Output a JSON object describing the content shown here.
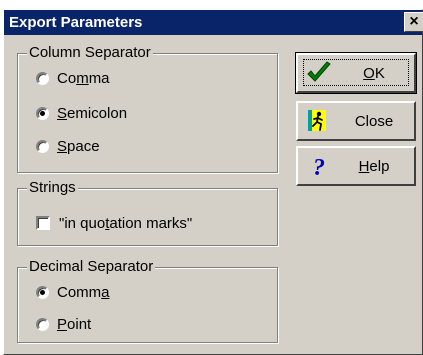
{
  "dialog": {
    "title": "Export Parameters",
    "close_glyph": "×"
  },
  "column_separator": {
    "legend": "Column Separator",
    "options": [
      {
        "pre": "Co",
        "key": "m",
        "post": "ma",
        "checked": false
      },
      {
        "pre": "",
        "key": "S",
        "post": "emicolon",
        "checked": true
      },
      {
        "pre": "",
        "key": "S",
        "post": "pace",
        "checked": false
      }
    ]
  },
  "strings": {
    "legend": "Strings",
    "checkbox": {
      "pre": "\"in quo",
      "key": "t",
      "post": "ation marks\"",
      "checked": false
    }
  },
  "decimal_separator": {
    "legend": "Decimal Separator",
    "options": [
      {
        "pre": "Comm",
        "key": "a",
        "post": "",
        "checked": true
      },
      {
        "pre": "",
        "key": "P",
        "post": "oint",
        "checked": false
      }
    ]
  },
  "buttons": {
    "ok": {
      "pre": "",
      "key": "O",
      "post": "K",
      "icon": "checkmark-icon"
    },
    "close": {
      "pre": "Close",
      "key": "",
      "post": "",
      "icon": "running-man-icon"
    },
    "help": {
      "pre": "",
      "key": "H",
      "post": "elp",
      "icon": "question-mark-icon"
    }
  }
}
